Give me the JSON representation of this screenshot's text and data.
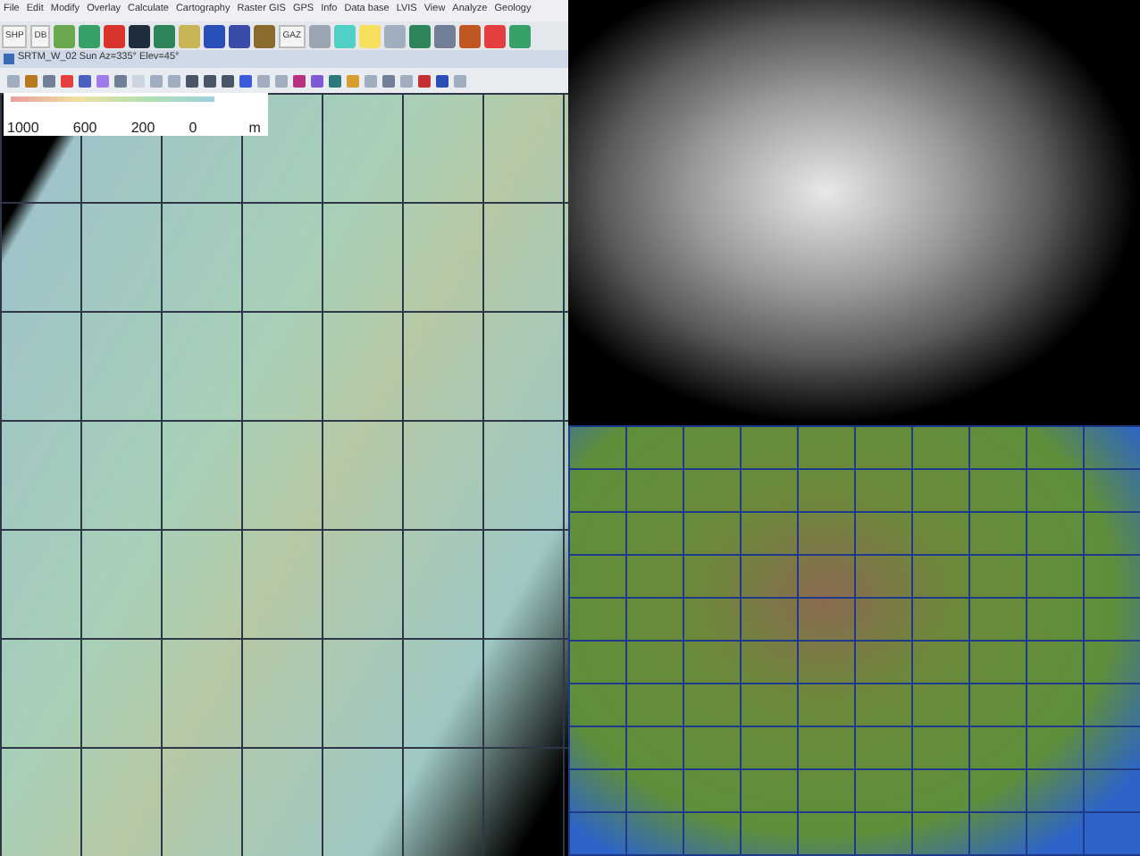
{
  "menu_bar": {
    "items": [
      "File",
      "Edit",
      "Modify",
      "Overlay",
      "Calculate",
      "Cartography",
      "Raster GIS",
      "GPS",
      "Info",
      "Data base",
      "LVIS",
      "View",
      "Analyze",
      "Geology"
    ]
  },
  "toolbar": {
    "buttons": [
      {
        "kind": "text",
        "label": "SHP"
      },
      {
        "kind": "text",
        "label": "DB"
      },
      {
        "kind": "icon",
        "color": "#6aa84f"
      },
      {
        "kind": "icon",
        "color": "#38a169"
      },
      {
        "kind": "icon",
        "color": "#d9342b"
      },
      {
        "kind": "icon",
        "color": "#1f2d3d"
      },
      {
        "kind": "icon",
        "color": "#2f855a"
      },
      {
        "kind": "icon",
        "color": "#c9b458"
      },
      {
        "kind": "icon",
        "color": "#2b4fb8"
      },
      {
        "kind": "icon",
        "color": "#3b4ca8"
      },
      {
        "kind": "icon",
        "color": "#8b6b2e"
      },
      {
        "kind": "text",
        "label": "GAZ"
      },
      {
        "kind": "icon",
        "color": "#9aa5b1"
      },
      {
        "kind": "icon",
        "color": "#4fd1c5"
      },
      {
        "kind": "icon",
        "color": "#f6e05e"
      },
      {
        "kind": "icon",
        "color": "#a0aec0"
      },
      {
        "kind": "icon",
        "color": "#2f855a"
      },
      {
        "kind": "icon",
        "color": "#718096"
      },
      {
        "kind": "icon",
        "color": "#c05621"
      },
      {
        "kind": "icon",
        "color": "#e53e3e"
      },
      {
        "kind": "icon",
        "color": "#38a169"
      }
    ]
  },
  "map_window": {
    "title": "SRTM_W_02 Sun Az=335° Elev=45°",
    "tools": [
      {
        "color": "#a0aec0"
      },
      {
        "color": "#b7791f"
      },
      {
        "color": "#718096"
      },
      {
        "color": "#e53e3e"
      },
      {
        "color": "#4a5fc1"
      },
      {
        "color": "#9f7aea"
      },
      {
        "color": "#718096"
      },
      {
        "color": "#cbd5e0"
      },
      {
        "color": "#a0aec0"
      },
      {
        "color": "#a0aec0"
      },
      {
        "color": "#4a5568"
      },
      {
        "color": "#4a5568"
      },
      {
        "color": "#4a5568"
      },
      {
        "color": "#3b5bdb"
      },
      {
        "color": "#a0aec0"
      },
      {
        "color": "#a0aec0"
      },
      {
        "color": "#b83280"
      },
      {
        "color": "#805ad5"
      },
      {
        "color": "#2c7a7b"
      },
      {
        "color": "#d69e2e"
      },
      {
        "color": "#a0aec0"
      },
      {
        "color": "#718096"
      },
      {
        "color": "#a0aec0"
      },
      {
        "color": "#c53030"
      },
      {
        "color": "#2b4fb8"
      },
      {
        "color": "#a0aec0"
      }
    ],
    "legend": {
      "ticks": [
        "1000",
        "600",
        "200",
        "0"
      ],
      "unit": "m"
    }
  }
}
